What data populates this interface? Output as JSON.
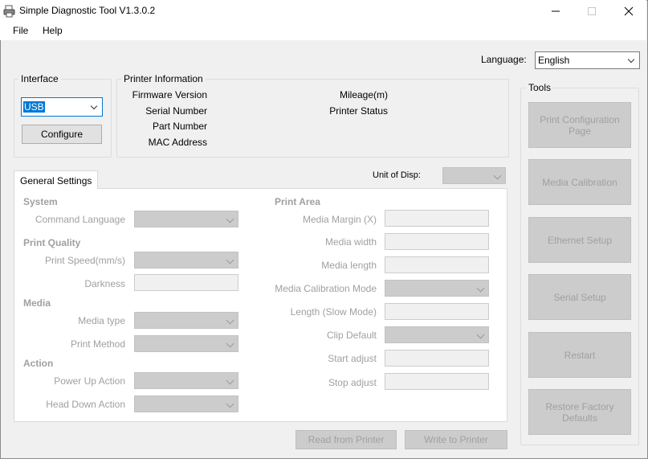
{
  "window": {
    "title": "Simple Diagnostic Tool V1.3.0.2"
  },
  "menu": {
    "items": [
      "File",
      "Help"
    ]
  },
  "language": {
    "label": "Language:",
    "value": "English"
  },
  "interface": {
    "title": "Interface",
    "value": "USB",
    "configure_label": "Configure"
  },
  "printer_info": {
    "title": "Printer Information",
    "left_labels": [
      "Firmware Version",
      "Serial Number",
      "Part Number",
      "MAC Address"
    ],
    "right_labels": [
      "Mileage(m)",
      "Printer Status"
    ]
  },
  "tools": {
    "title": "Tools",
    "buttons": [
      "Print Configuration Page",
      "Media Calibration",
      "Ethernet Setup",
      "Serial Setup",
      "Restart",
      "Restore Factory Defaults"
    ]
  },
  "settings": {
    "tab_label": "General Settings",
    "unit_label": "Unit of Disp:",
    "system": {
      "heading": "System",
      "command_language": "Command Language"
    },
    "print_quality": {
      "heading": "Print Quality",
      "print_speed": "Print Speed(mm/s)",
      "darkness": "Darkness"
    },
    "media": {
      "heading": "Media",
      "media_type": "Media type",
      "print_method": "Print Method"
    },
    "action": {
      "heading": "Action",
      "power_up": "Power Up Action",
      "head_down": "Head Down Action"
    },
    "print_area": {
      "heading": "Print Area",
      "media_margin": "Media Margin (X)",
      "media_width": "Media width",
      "media_length": "Media length",
      "calibration_mode": "Media Calibration Mode",
      "length_slow": "Length (Slow Mode)",
      "clip_default": "Clip Default",
      "start_adjust": "Start adjust",
      "stop_adjust": "Stop adjust"
    }
  },
  "actions": {
    "read_label": "Read from Printer",
    "write_label": "Write to Printer"
  }
}
